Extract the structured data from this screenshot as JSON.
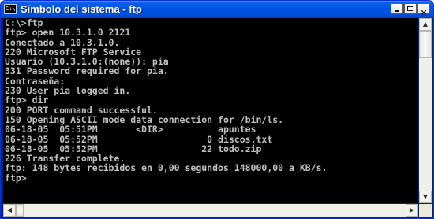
{
  "window": {
    "title": "Símbolo del sistema - ftp",
    "icon_label": "C:\\",
    "close_glyph": "✕"
  },
  "console": {
    "lines": [
      "C:\\>ftp",
      "ftp> open 10.3.1.0 2121",
      "Conectado a 10.3.1.0.",
      "220 Microsoft FTP Service",
      "Usuario (10.3.1.0:(none)): pia",
      "331 Password required for pia.",
      "Contraseña:",
      "230 User pia logged in.",
      "ftp> dir",
      "200 PORT command successful.",
      "150 Opening ASCII mode data connection for /bin/ls.",
      "06-18-05  05:51PM       <DIR>          apuntes",
      "06-18-05  05:52PM                    0 discos.txt",
      "06-18-05  05:52PM                   22 todo.zip",
      "226 Transfer complete.",
      "ftp: 148 bytes recibidos en 0,00 segundos 148000,00 a KB/s.",
      "ftp>"
    ]
  },
  "scrollbars": {
    "up_arrow": "▲",
    "down_arrow": "▼",
    "left_arrow": "◀",
    "right_arrow": "▶"
  }
}
